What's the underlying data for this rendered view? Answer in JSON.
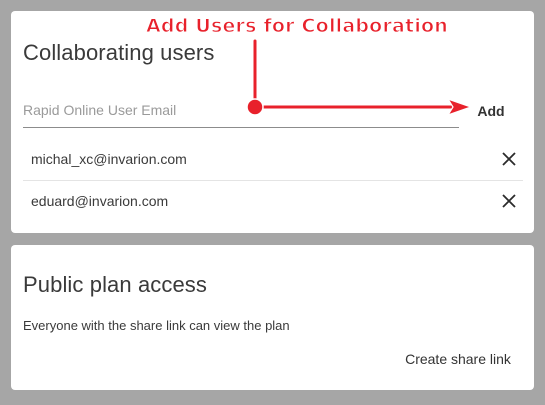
{
  "annotation": {
    "text": "Add Users for Collaboration",
    "color": "#e8212b"
  },
  "collaborating": {
    "title": "Collaborating users",
    "email_placeholder": "Rapid Online User Email",
    "email_value": "",
    "add_label": "Add",
    "users": [
      {
        "email": "michal_xc@invarion.com",
        "remove_icon": "close-icon"
      },
      {
        "email": "eduard@invarion.com",
        "remove_icon": "close-icon"
      }
    ]
  },
  "public_access": {
    "title": "Public plan access",
    "description": "Everyone with the share link can view the plan",
    "share_label": "Create share link"
  },
  "colors": {
    "background": "#a6a6a6",
    "card": "#ffffff",
    "annotation": "#e8212b"
  }
}
